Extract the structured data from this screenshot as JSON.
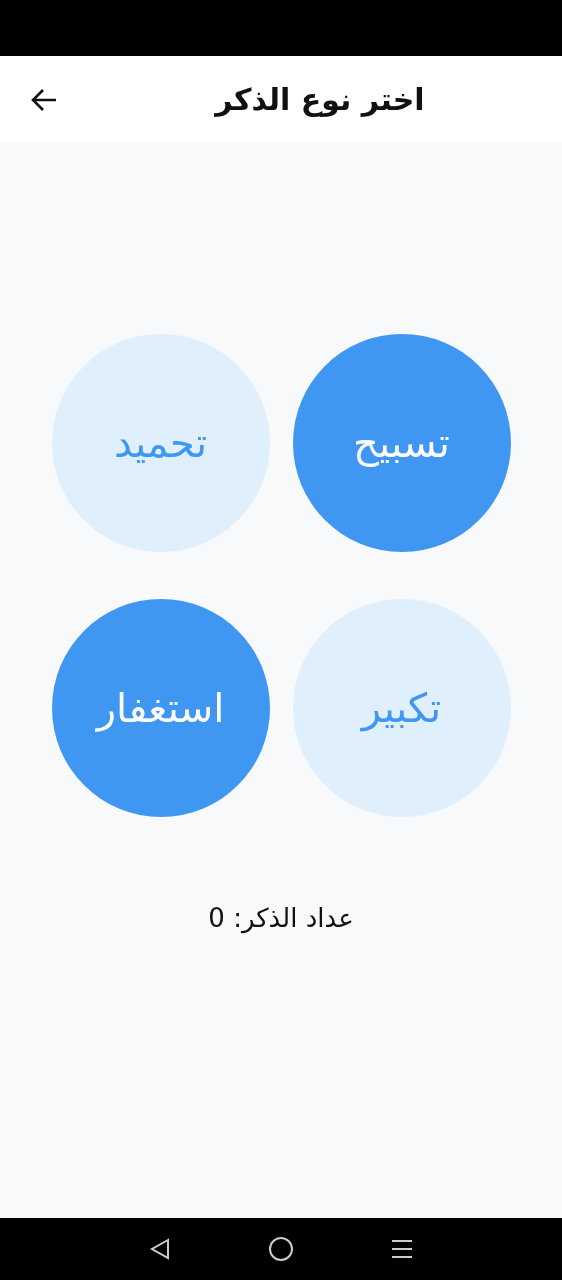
{
  "app_bar": {
    "title": "اختر نوع الذكر"
  },
  "dhikr_types": [
    {
      "label": "تسبيح",
      "kind": "filled"
    },
    {
      "label": "تحميد",
      "kind": "light"
    },
    {
      "label": "تكبير",
      "kind": "light"
    },
    {
      "label": "استغفار",
      "kind": "filled"
    }
  ],
  "counter": "عداد الذكر: 0"
}
